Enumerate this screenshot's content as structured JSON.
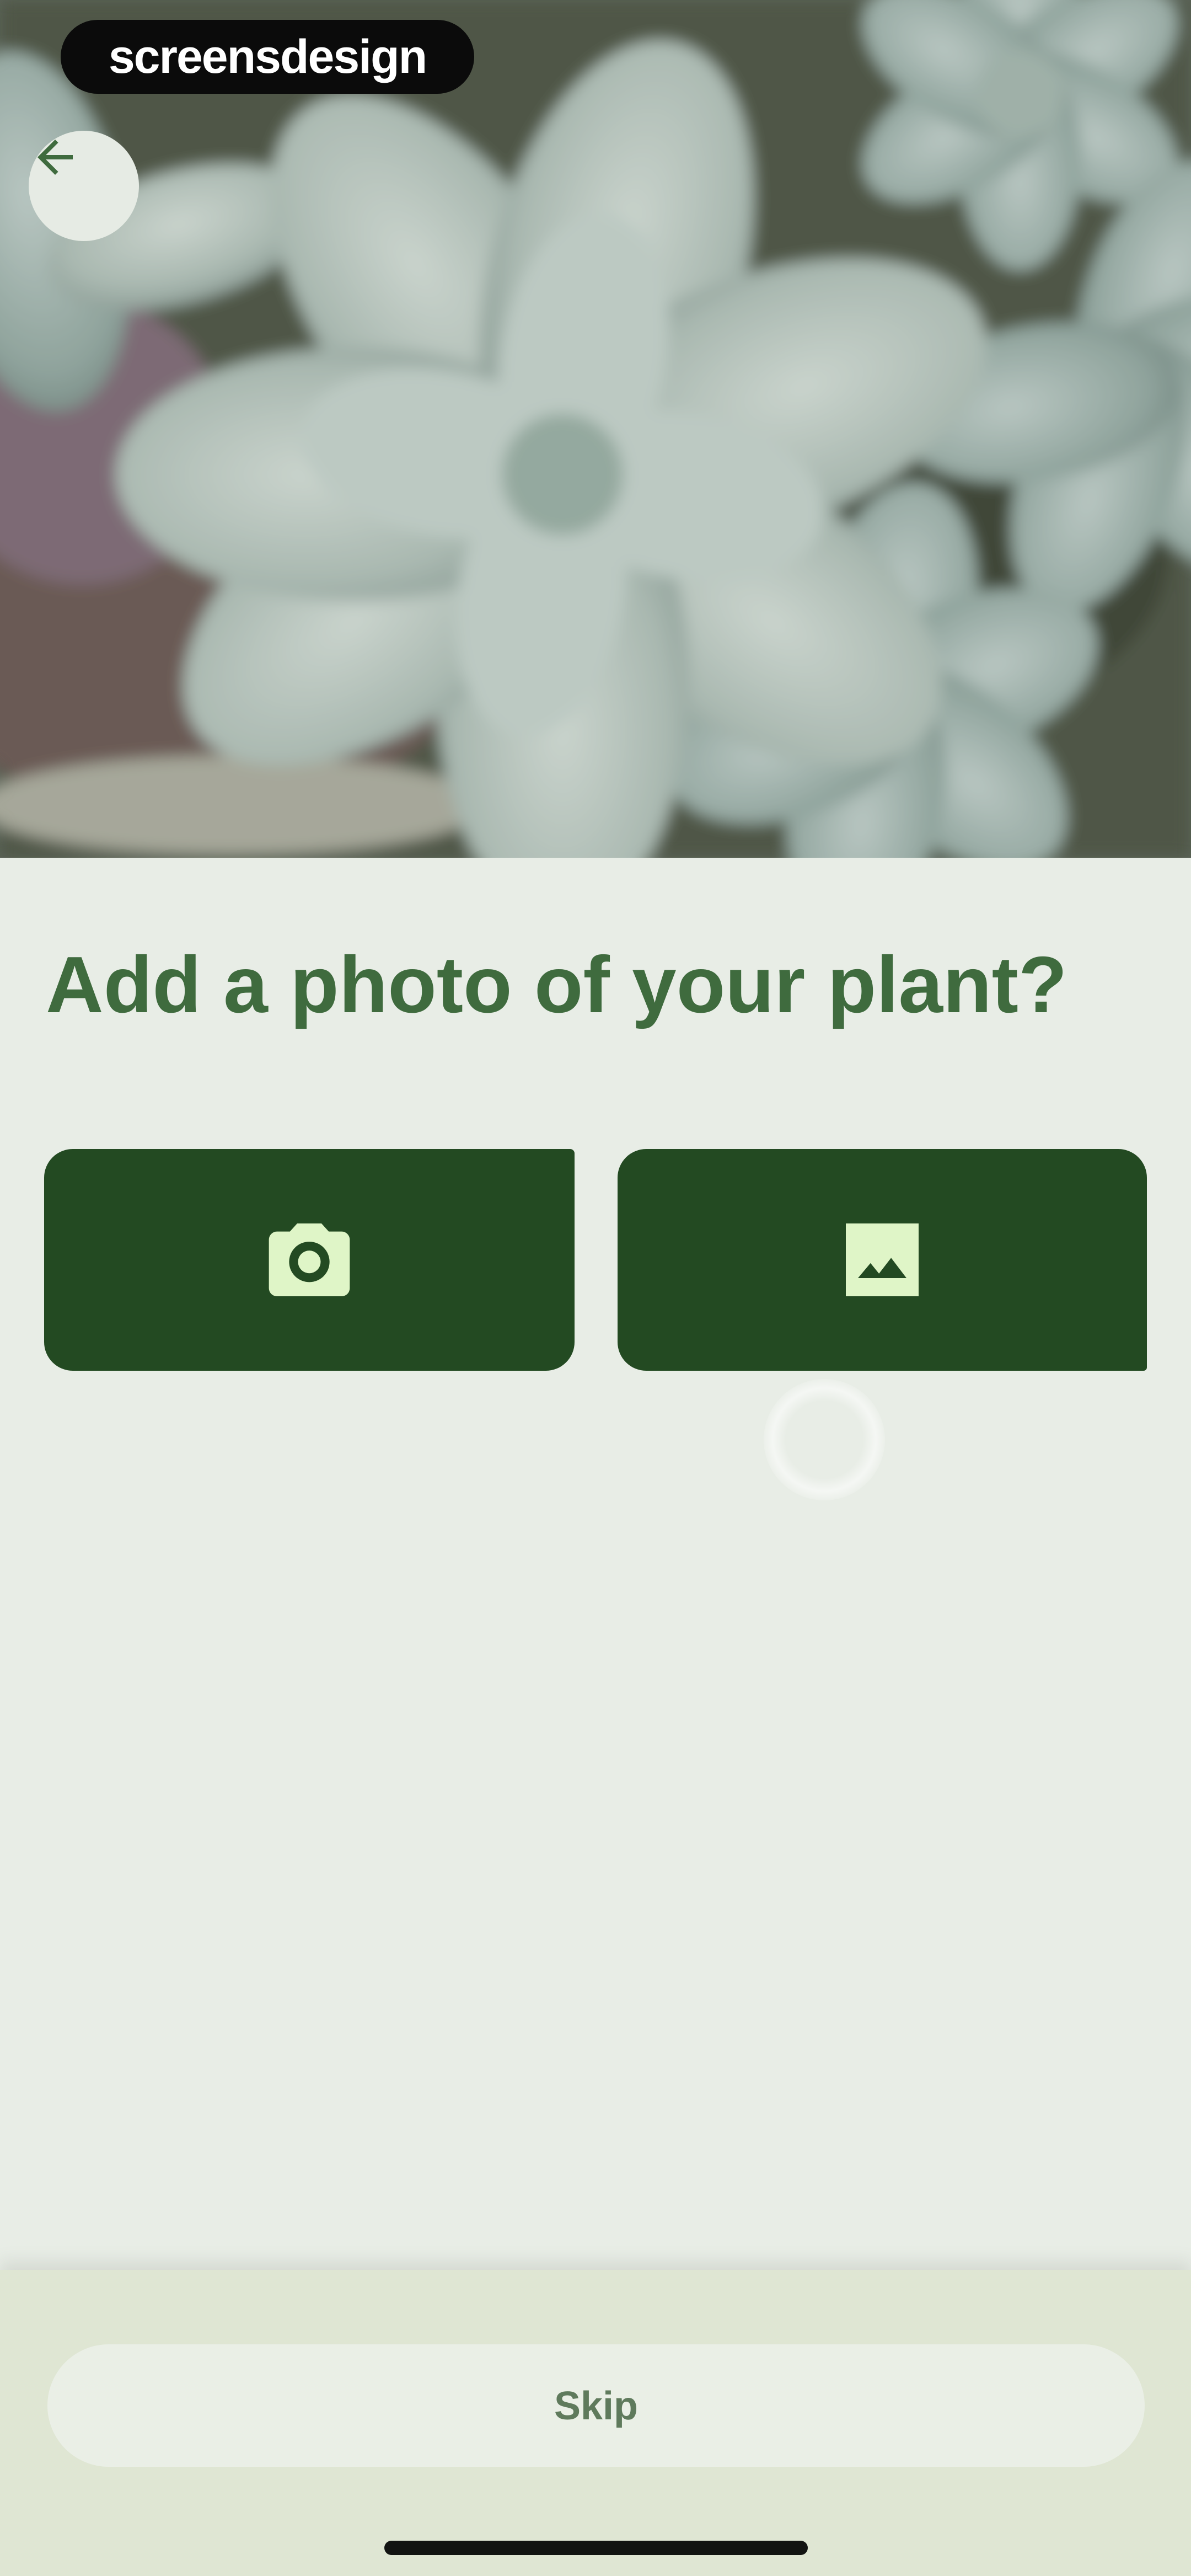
{
  "watermark": {
    "text": "screensdesign"
  },
  "header": {
    "back_icon": "arrow-left-icon"
  },
  "main": {
    "title": "Add a photo of your plant?",
    "actions": [
      {
        "name": "camera-button",
        "icon": "camera-icon"
      },
      {
        "name": "gallery-button",
        "icon": "image-icon"
      }
    ]
  },
  "footer": {
    "skip_label": "Skip"
  },
  "colors": {
    "title": "#3f6b3e",
    "button_bg": "#234a22",
    "icon_fill": "#dff5c7",
    "page_bg": "#e8ede6",
    "footer_bg": "#dfe6d3",
    "skip_text": "#5f7a5c"
  }
}
